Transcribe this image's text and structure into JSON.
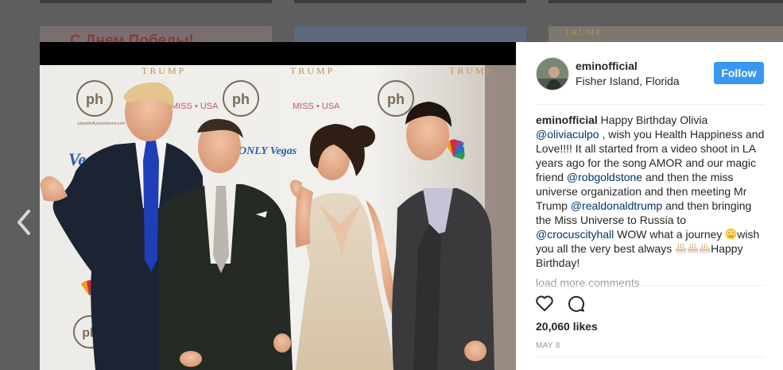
{
  "background": {
    "top_tile_text": "С Днем Победы!",
    "right_tile_text": "TRUMP"
  },
  "post": {
    "user": {
      "username": "eminofficial",
      "location": "Fisher Island, Florida",
      "avatar": "avatar-photo"
    },
    "follow_label": "Follow",
    "caption": [
      {
        "t": "author",
        "v": "eminofficial"
      },
      {
        "t": "text",
        "v": " Happy Birthday Olivia "
      },
      {
        "t": "mention",
        "v": "@oliviaculpo"
      },
      {
        "t": "text",
        "v": " , wish you Health Happiness and Love!!!! It all started from a video shoot in LA years ago for the song AMOR and our magic friend "
      },
      {
        "t": "mention",
        "v": "@robgoldstone"
      },
      {
        "t": "text",
        "v": " and then the miss universe organization and then meeting Mr Trump "
      },
      {
        "t": "mention",
        "v": "@realdonaldtrump"
      },
      {
        "t": "text",
        "v": " and then bringing the Miss Universe to Russia to "
      },
      {
        "t": "mention",
        "v": "@crocuscityhall"
      },
      {
        "t": "text",
        "v": " WOW what a journey "
      },
      {
        "t": "emoji",
        "v": "smiling-face-emoji"
      },
      {
        "t": "text",
        "v": "wish you all the very best always "
      },
      {
        "t": "emoji",
        "v": "cake-emoji"
      },
      {
        "t": "emoji",
        "v": "cake-emoji"
      },
      {
        "t": "emoji",
        "v": "cake-emoji"
      },
      {
        "t": "text",
        "v": "Happy Birthday!"
      }
    ],
    "load_more_label": "load more comments",
    "actions": {
      "like_icon": "heart-icon",
      "comment_icon": "comment-icon"
    },
    "likes": "20,060 likes",
    "date": "MAY 8",
    "photo": {
      "backdrop_words": [
        "TRUMP",
        "TRUMP",
        "TRUMP",
        "MISS • USA",
        "MISS • USA",
        "ph",
        "ph",
        "ph",
        "ph",
        "Vegas",
        "ONLY Vegas",
        "planethollywoodresort.com"
      ],
      "icon": "photo-with-four-people"
    }
  },
  "nav": {
    "prev_icon": "chevron-left-icon"
  },
  "colors": {
    "accent": "#3897f0",
    "mention": "#003569",
    "text": "#262626",
    "muted": "#999999"
  }
}
